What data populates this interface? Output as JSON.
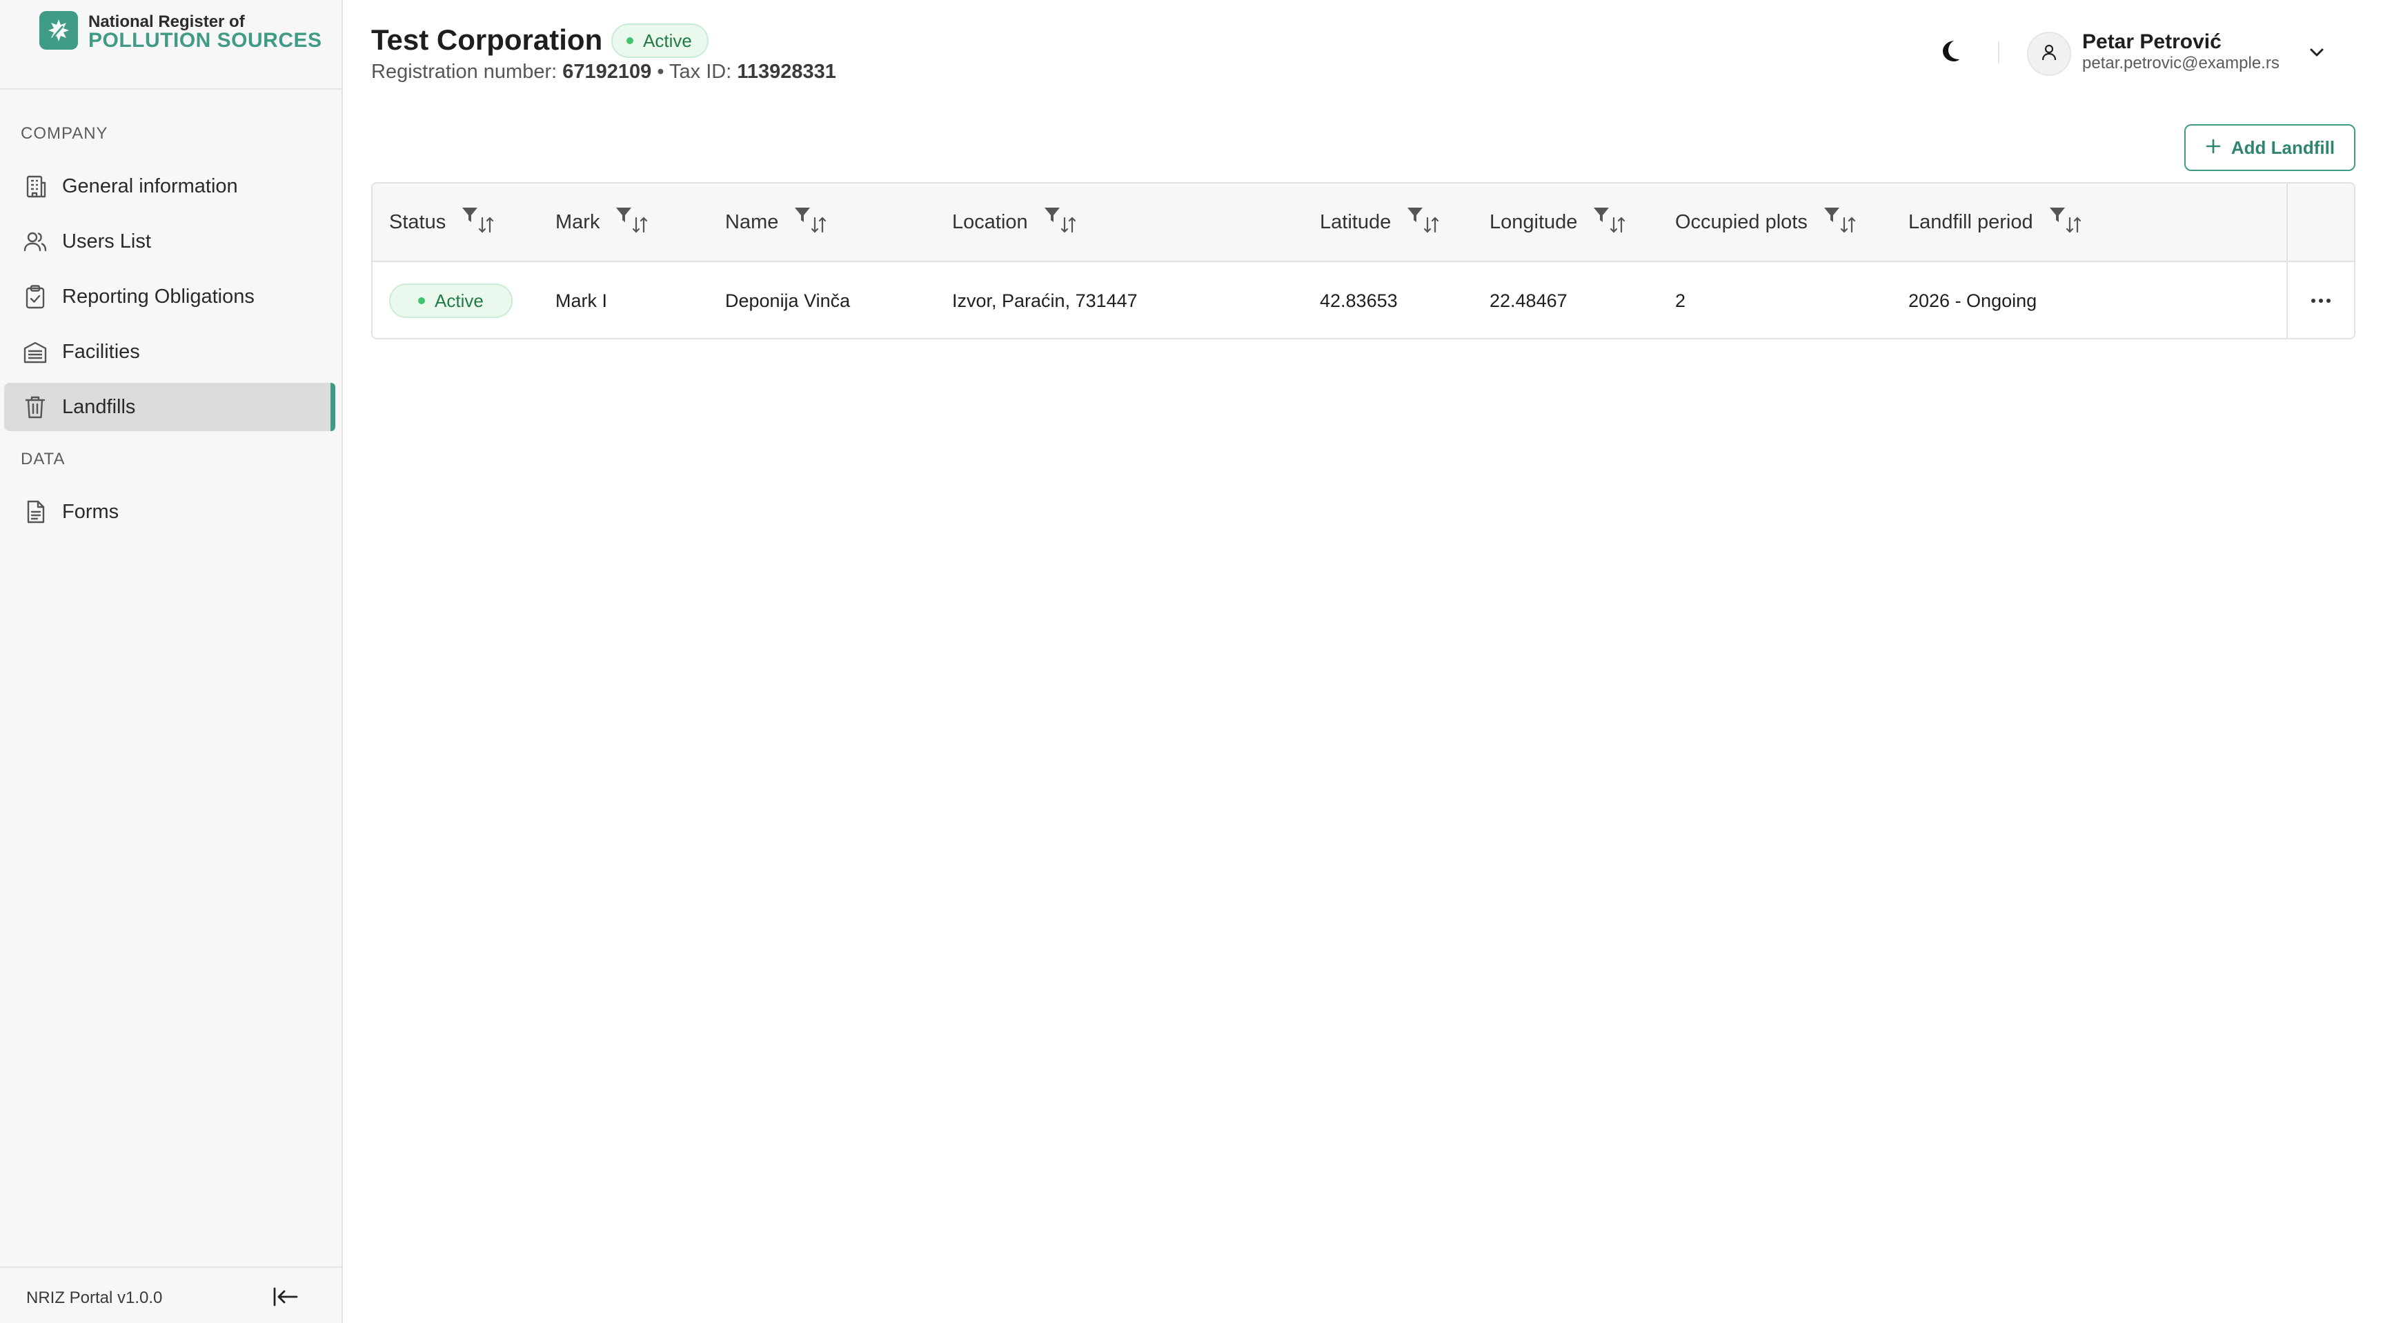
{
  "brand": {
    "line1": "National Register of",
    "line2": "POLLUTION SOURCES",
    "accent_color": "#3f9b85"
  },
  "sidebar": {
    "sections": [
      {
        "label": "COMPANY",
        "items": [
          {
            "label": "General information",
            "icon": "building-icon",
            "active": false
          },
          {
            "label": "Users List",
            "icon": "users-icon",
            "active": false
          },
          {
            "label": "Reporting Obligations",
            "icon": "clipboard-check-icon",
            "active": false
          },
          {
            "label": "Facilities",
            "icon": "facility-icon",
            "active": false
          },
          {
            "label": "Landfills",
            "icon": "trash-icon",
            "active": true
          }
        ]
      },
      {
        "label": "DATA",
        "items": [
          {
            "label": "Forms",
            "icon": "document-icon",
            "active": false
          }
        ]
      }
    ],
    "footer": {
      "version": "NRIZ Portal v1.0.0",
      "collapse_icon": "collapse-left-icon"
    }
  },
  "header": {
    "title": "Test Corporation",
    "status": "Active",
    "registration_label": "Registration number:",
    "registration_number": "67192109",
    "separator": "•",
    "tax_label": "Tax ID:",
    "tax_id": "113928331",
    "theme_icon": "moon-icon",
    "user": {
      "name": "Petar Petrović",
      "email": "petar.petrovic@example.rs"
    }
  },
  "toolbar": {
    "add_label": "Add Landfill"
  },
  "table": {
    "columns": [
      "Status",
      "Mark",
      "Name",
      "Location",
      "Latitude",
      "Longitude",
      "Occupied plots",
      "Landfill period"
    ],
    "rows": [
      {
        "status": "Active",
        "mark": "Mark I",
        "name": "Deponija Vinča",
        "location": "Izvor, Paraćin, 731447",
        "latitude": "42.83653",
        "longitude": "22.48467",
        "occupied_plots": "2",
        "landfill_period": "2026 - Ongoing"
      }
    ]
  },
  "colors": {
    "status_green": "#42c26a",
    "status_bg": "#eaf8ee",
    "active_nav_bg": "#dcdcdc"
  }
}
